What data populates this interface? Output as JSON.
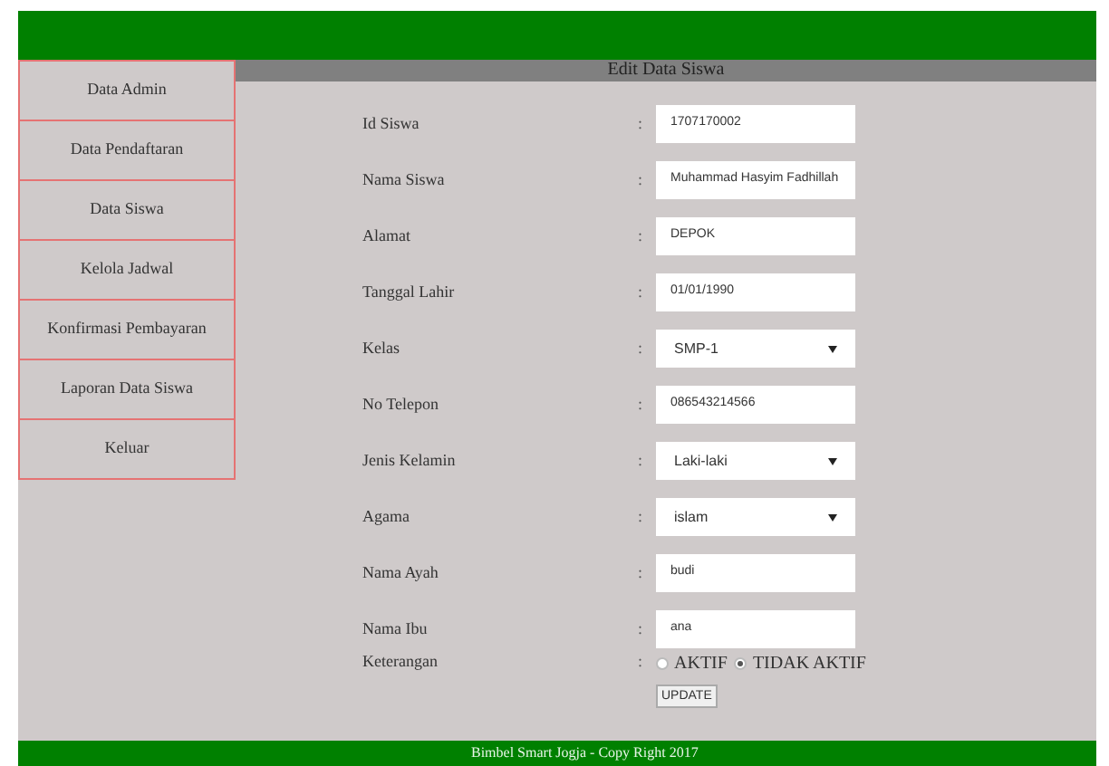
{
  "sidebar": {
    "items": [
      {
        "label": "Data Admin",
        "selected": false
      },
      {
        "label": "Data Pendaftaran",
        "selected": false
      },
      {
        "label": "Data Siswa",
        "selected": false
      },
      {
        "label": "Kelola Jadwal",
        "selected": false
      },
      {
        "label": "Konfirmasi Pembayaran",
        "selected": false
      },
      {
        "label": "Laporan Data Siswa",
        "selected": false
      },
      {
        "label": "Keluar",
        "selected": false
      }
    ]
  },
  "form": {
    "title": "Edit Data Siswa",
    "fields": [
      {
        "label": "Id Siswa",
        "kind": "text",
        "value": "1707170002"
      },
      {
        "label": "Nama Siswa",
        "kind": "text",
        "value": "Muhammad Hasyim Fadhillah"
      },
      {
        "label": "Alamat",
        "kind": "text",
        "value": "DEPOK"
      },
      {
        "label": "Tanggal Lahir",
        "kind": "date",
        "value": "01/01/1990"
      },
      {
        "label": "Kelas",
        "kind": "select",
        "value": "SMP-1"
      },
      {
        "label": "No Telepon",
        "kind": "text",
        "value": "086543214566"
      },
      {
        "label": "Jenis Kelamin",
        "kind": "select",
        "value": "Laki-laki"
      },
      {
        "label": "Agama",
        "kind": "select",
        "value": "islam"
      },
      {
        "label": "Nama Ayah",
        "kind": "text",
        "value": "budi"
      },
      {
        "label": "Nama Ibu",
        "kind": "text",
        "value": "ana"
      },
      {
        "label": "Keterangan",
        "kind": "radio",
        "options": [
          {
            "label": "AKTIF",
            "selected": false
          },
          {
            "label": "TIDAK AKTIF",
            "selected": true
          }
        ]
      }
    ],
    "colon": ":",
    "submit": "UPDATE"
  },
  "footer": "Bimbel Smart Jogja - Copy Right 2017"
}
